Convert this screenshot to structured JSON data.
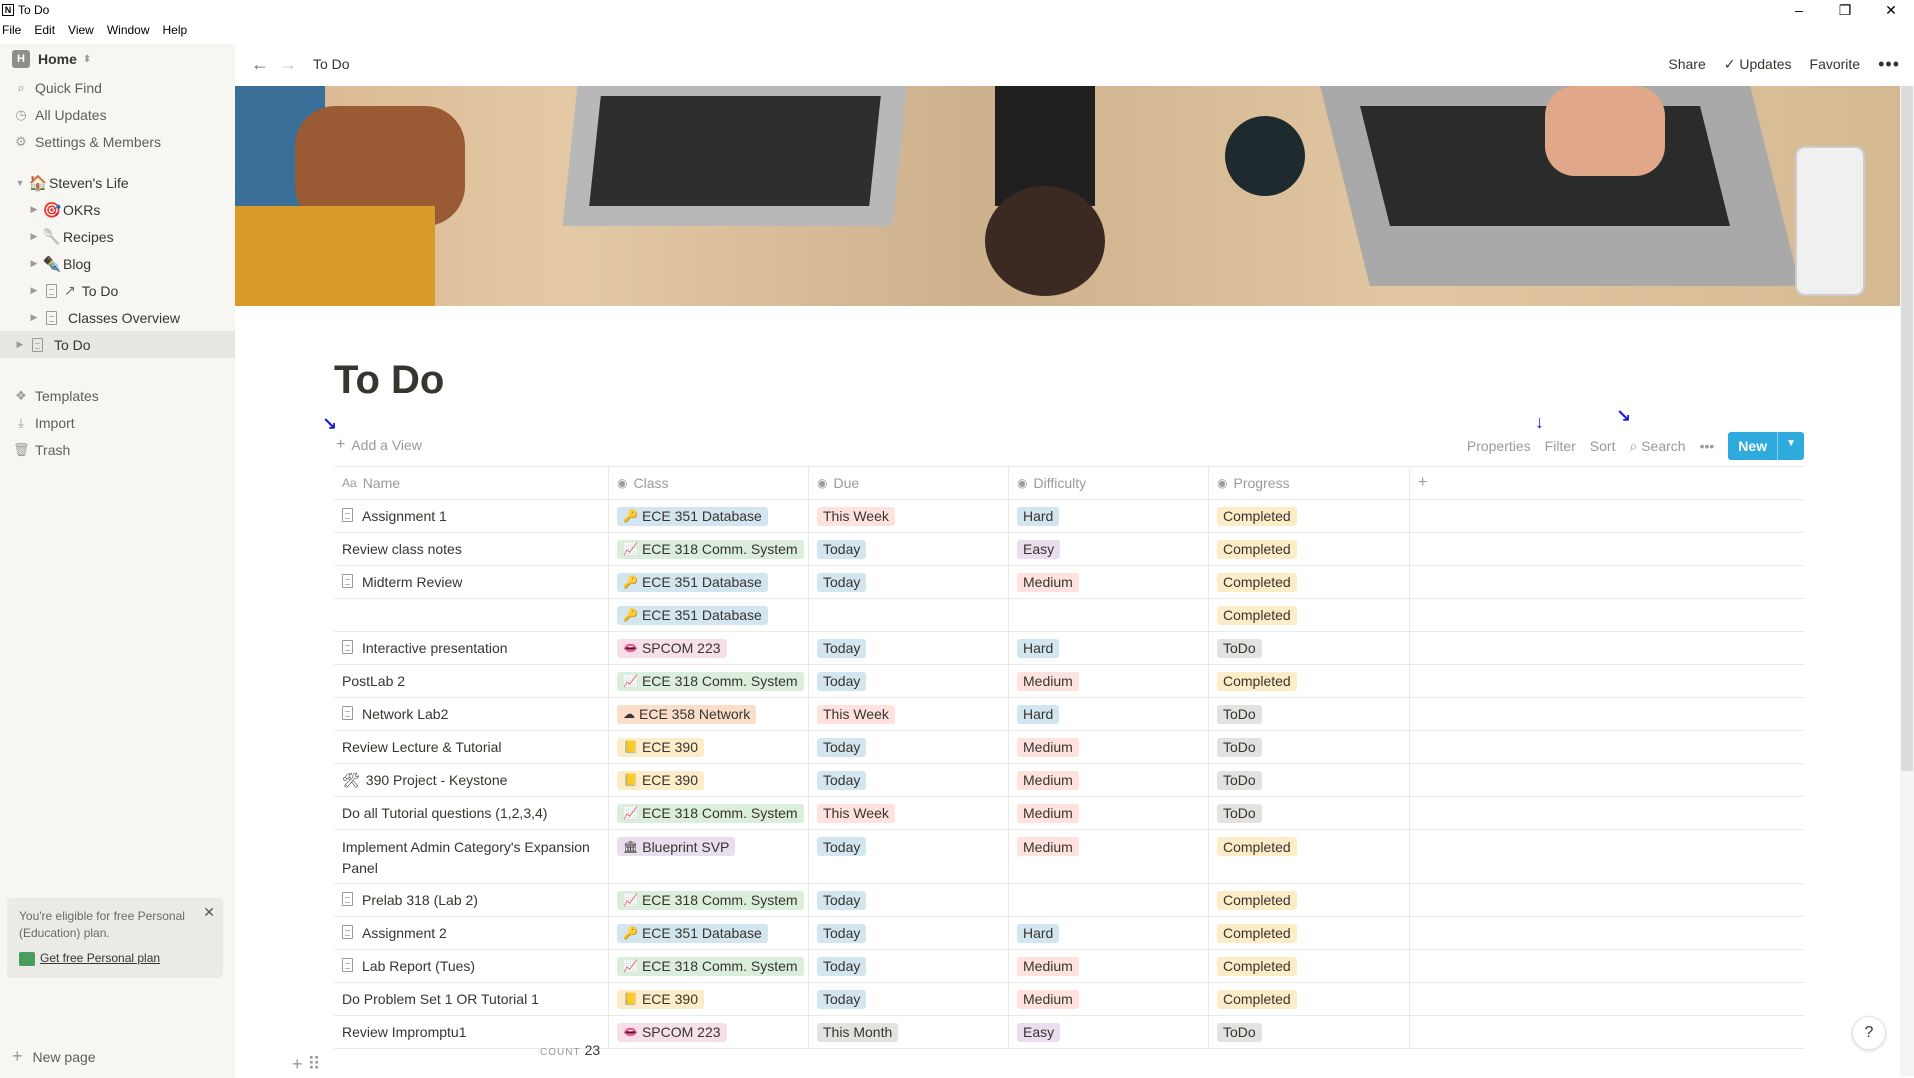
{
  "window": {
    "title": "To Do",
    "controls": [
      "–",
      "❐",
      "✕"
    ]
  },
  "menu": [
    "File",
    "Edit",
    "View",
    "Window",
    "Help"
  ],
  "sidebar": {
    "workspace": "Home",
    "workspace_icon": "H",
    "nav": [
      {
        "label": "Quick Find",
        "icon": "search-icon"
      },
      {
        "label": "All Updates",
        "icon": "clock-icon"
      },
      {
        "label": "Settings & Members",
        "icon": "gear-icon"
      }
    ],
    "tree": [
      {
        "label": "Steven's Life",
        "emoji": "🏠",
        "level": 0,
        "expanded": true
      },
      {
        "label": "OKRs",
        "emoji": "🎯",
        "level": 1
      },
      {
        "label": "Recipes",
        "emoji": "🥄",
        "level": 1
      },
      {
        "label": "Blog",
        "emoji": "✒️",
        "level": 1
      },
      {
        "label": "To Do",
        "prefix": "↗",
        "level": 1
      },
      {
        "label": "Classes Overview",
        "level": 1
      },
      {
        "label": "To Do",
        "level": 0,
        "active": true
      }
    ],
    "lower": [
      {
        "label": "Templates",
        "icon": "templates-icon"
      },
      {
        "label": "Import",
        "icon": "import-icon"
      },
      {
        "label": "Trash",
        "icon": "trash-icon"
      }
    ],
    "promo": {
      "text": "You're eligible for free Personal (Education) plan.",
      "link": "Get free Personal plan"
    },
    "new_page": "New page"
  },
  "topbar": {
    "breadcrumb": "To Do",
    "share": "Share",
    "updates": "Updates",
    "favorite": "Favorite"
  },
  "page": {
    "title": "To Do",
    "add_view": "Add a View",
    "tools": {
      "properties": "Properties",
      "filter": "Filter",
      "sort": "Sort",
      "search": "Search",
      "new": "New"
    }
  },
  "table": {
    "columns": [
      "Name",
      "Class",
      "Due",
      "Difficulty",
      "Progress"
    ],
    "rows": [
      {
        "name": "Assignment 1",
        "doc": true,
        "class": "ECE 351 Database",
        "class_color": "blue",
        "class_icon": "🔑",
        "due": "This Week",
        "due_color": "red",
        "diff": "Hard",
        "diff_color": "blue",
        "prog": "Completed",
        "prog_color": "yellow"
      },
      {
        "name": "Review class notes",
        "class": "ECE 318 Comm. System",
        "class_color": "green",
        "class_icon": "📈",
        "due": "Today",
        "due_color": "blue",
        "diff": "Easy",
        "diff_color": "purple",
        "prog": "Completed",
        "prog_color": "yellow"
      },
      {
        "name": "Midterm Review",
        "doc": true,
        "class": "ECE 351 Database",
        "class_color": "blue",
        "class_icon": "🔑",
        "due": "Today",
        "due_color": "blue",
        "diff": "Medium",
        "diff_color": "red",
        "prog": "Completed",
        "prog_color": "yellow"
      },
      {
        "name": "",
        "class": "ECE 351 Database",
        "class_color": "blue",
        "class_icon": "🔑",
        "due": "",
        "diff": "",
        "prog": "Completed",
        "prog_color": "yellow"
      },
      {
        "name": "Interactive presentation",
        "doc": true,
        "class": "SPCOM 223",
        "class_color": "pink",
        "class_icon": "👄",
        "due": "Today",
        "due_color": "blue",
        "diff": "Hard",
        "diff_color": "blue",
        "prog": "ToDo",
        "prog_color": "gray"
      },
      {
        "name": "PostLab 2",
        "class": "ECE 318 Comm. System",
        "class_color": "green",
        "class_icon": "📈",
        "due": "Today",
        "due_color": "blue",
        "diff": "Medium",
        "diff_color": "red",
        "prog": "Completed",
        "prog_color": "yellow"
      },
      {
        "name": "Network Lab2",
        "doc": true,
        "class": "ECE 358 Network",
        "class_color": "orange",
        "class_icon": "☁",
        "due": "This Week",
        "due_color": "red",
        "diff": "Hard",
        "diff_color": "blue",
        "prog": "ToDo",
        "prog_color": "gray"
      },
      {
        "name": "Review Lecture & Tutorial",
        "class": "ECE 390",
        "class_color": "yellow",
        "class_icon": "📒",
        "due": "Today",
        "due_color": "blue",
        "diff": "Medium",
        "diff_color": "red",
        "prog": "ToDo",
        "prog_color": "gray"
      },
      {
        "name": "390 Project - Keystone",
        "emoji": "🛠",
        "class": "ECE 390",
        "class_color": "yellow",
        "class_icon": "📒",
        "due": "Today",
        "due_color": "blue",
        "diff": "Medium",
        "diff_color": "red",
        "prog": "ToDo",
        "prog_color": "gray"
      },
      {
        "name": "Do all Tutorial questions (1,2,3,4)",
        "class": "ECE 318 Comm. System",
        "class_color": "green",
        "class_icon": "📈",
        "due": "This Week",
        "due_color": "red",
        "diff": "Medium",
        "diff_color": "red",
        "prog": "ToDo",
        "prog_color": "gray"
      },
      {
        "name": "Implement Admin Category's Expansion Panel",
        "tall": true,
        "class": "Blueprint SVP",
        "class_color": "purple",
        "class_icon": "🏛",
        "due": "Today",
        "due_color": "blue",
        "diff": "Medium",
        "diff_color": "red",
        "prog": "Completed",
        "prog_color": "yellow"
      },
      {
        "name": "Prelab 318 (Lab 2)",
        "doc": true,
        "class": "ECE 318 Comm. System",
        "class_color": "green",
        "class_icon": "📈",
        "due": "Today",
        "due_color": "blue",
        "diff": "",
        "prog": "Completed",
        "prog_color": "yellow"
      },
      {
        "name": "Assignment 2",
        "doc": true,
        "class": "ECE 351 Database",
        "class_color": "blue",
        "class_icon": "🔑",
        "due": "Today",
        "due_color": "blue",
        "diff": "Hard",
        "diff_color": "blue",
        "prog": "Completed",
        "prog_color": "yellow"
      },
      {
        "name": "Lab Report (Tues)",
        "doc": true,
        "class": "ECE 318 Comm. System",
        "class_color": "green",
        "class_icon": "📈",
        "due": "Today",
        "due_color": "blue",
        "diff": "Medium",
        "diff_color": "red",
        "prog": "Completed",
        "prog_color": "yellow"
      },
      {
        "name": "Do Problem Set 1 OR Tutorial 1",
        "class": "ECE 390",
        "class_color": "yellow",
        "class_icon": "📒",
        "due": "Today",
        "due_color": "blue",
        "diff": "Medium",
        "diff_color": "red",
        "prog": "Completed",
        "prog_color": "yellow"
      },
      {
        "name": "Review Impromptu1",
        "class": "SPCOM 223",
        "class_color": "pink",
        "class_icon": "👄",
        "due": "This Month",
        "due_color": "gray",
        "diff": "Easy",
        "diff_color": "purple",
        "prog": "ToDo",
        "prog_color": "gray"
      }
    ],
    "count_label": "COUNT",
    "count": "23"
  },
  "help": "?"
}
